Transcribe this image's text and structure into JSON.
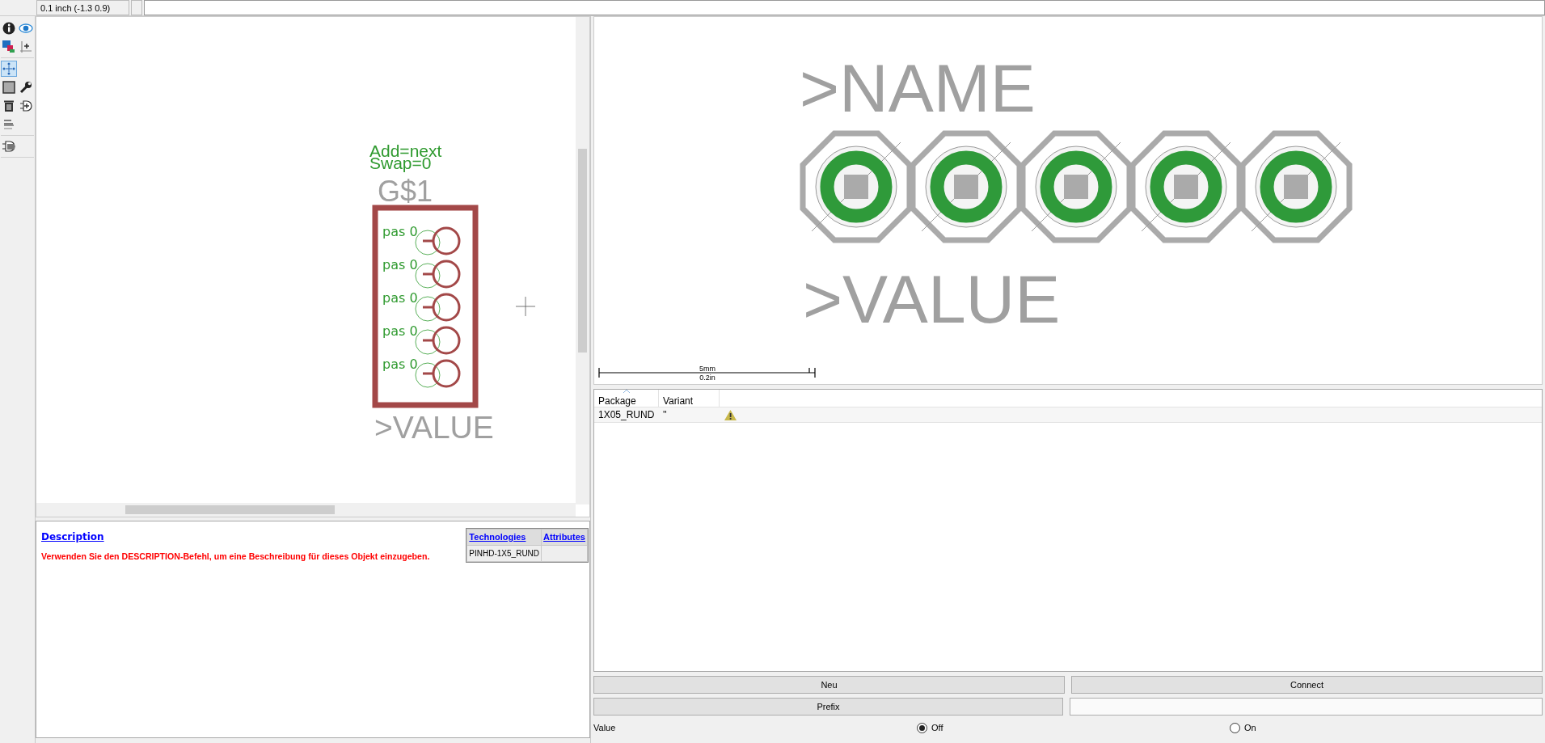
{
  "top_bar": {
    "coordinate": "0.1 inch (-1.3 0.9)"
  },
  "tool_groups": [
    {
      "tools": [
        {
          "kind": "info",
          "selected": false
        },
        {
          "kind": "eye",
          "selected": false
        },
        {
          "kind": "layers",
          "selected": false
        },
        {
          "kind": "mark",
          "selected": false
        }
      ]
    },
    {
      "tools": [
        {
          "kind": "move",
          "selected": true
        },
        {
          "kind": "square",
          "selected": false
        },
        {
          "kind": "wrench",
          "selected": false
        },
        {
          "kind": "trash",
          "selected": false
        },
        {
          "kind": "plug",
          "selected": false
        },
        {
          "kind": "value",
          "selected": false
        }
      ]
    },
    {
      "tools": [
        {
          "kind": "gate",
          "selected": false
        }
      ]
    }
  ],
  "schematic": {
    "gate_labels": [
      "Add=next",
      "Swap=0"
    ],
    "name": "G$1",
    "value": ">VALUE",
    "pins": [
      {
        "label": "pas 0"
      },
      {
        "label": "pas 0"
      },
      {
        "label": "pas 0"
      },
      {
        "label": "pas 0"
      },
      {
        "label": "pas 0"
      }
    ]
  },
  "description": {
    "heading": "Description",
    "text": "Verwenden Sie den DESCRIPTION-Befehl, um eine Beschreibung für dieses Objekt einzugeben.",
    "columns": [
      "Technologies",
      "Attributes"
    ],
    "rows": [
      {
        "technology": "PINHD-1X5_RUND"
      }
    ]
  },
  "package_preview": {
    "name": ">NAME",
    "value": ">VALUE",
    "pads": [
      {
        "kind": "octagon"
      },
      {
        "kind": "octagon"
      },
      {
        "kind": "octagon"
      },
      {
        "kind": "octagon"
      },
      {
        "kind": "octagon"
      }
    ],
    "scale": {
      "metric": "5mm",
      "imperial": "0.2in"
    }
  },
  "packages": {
    "columns": [
      {
        "label": "Package",
        "sorted": true
      },
      {
        "label": "Variant",
        "sorted": false
      }
    ],
    "rows": [
      {
        "package": "1X05_RUND",
        "variant": "''",
        "warning": true,
        "selected": false
      }
    ]
  },
  "buttons": [
    "Neu",
    "Connect",
    "Prefix"
  ],
  "prefix_field": {
    "kind": "text"
  },
  "value_option": {
    "label": "Value",
    "options": [
      {
        "label": "Off",
        "selected": true
      },
      {
        "label": "On",
        "selected": false
      }
    ]
  }
}
